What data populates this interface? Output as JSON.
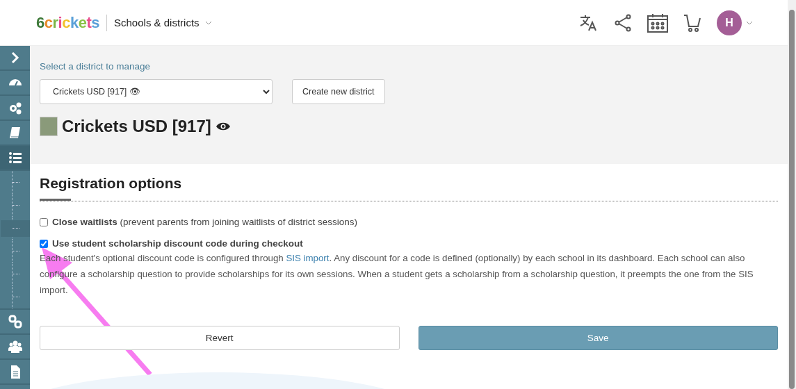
{
  "header": {
    "logo": "6crickets",
    "section": "Schools & districts",
    "avatar": "H"
  },
  "sidebar": {
    "items": [
      {
        "kind": "expand",
        "selected": false
      },
      {
        "kind": "dashboard",
        "selected": false
      },
      {
        "kind": "settings",
        "selected": false
      },
      {
        "kind": "book",
        "selected": false
      },
      {
        "kind": "list",
        "selected": true,
        "children": [
          {
            "selected": false
          },
          {
            "selected": false
          },
          {
            "selected": true
          },
          {
            "selected": false
          },
          {
            "selected": false
          },
          {
            "selected": false
          }
        ]
      },
      {
        "kind": "link",
        "selected": false
      },
      {
        "kind": "users",
        "selected": false
      },
      {
        "kind": "document",
        "selected": false
      }
    ]
  },
  "district": {
    "select_label": "Select a district to manage",
    "selected_district": "Crickets USD [917] 👁",
    "create_button": "Create new district",
    "title": "Crickets USD [917]"
  },
  "registration": {
    "heading": "Registration options",
    "options": [
      {
        "label": "Close waitlists",
        "note": "(prevent parents from joining waitlists of district sessions)",
        "checked": false
      },
      {
        "label": "Use student scholarship discount code during checkout",
        "checked": true,
        "description_before": "Each student's optional discount code is configured through ",
        "link": "SIS import",
        "description_after": ". Any discount for a code is defined (optionally) by each school in its dashboard. Each school can also configure a scholarship question to provide scholarships for its own sessions. When a student gets a scholarship from a scholarship question, it preempts the one from the SIS import."
      }
    ],
    "buttons": [
      {
        "kind": "secondary",
        "label": "Revert"
      },
      {
        "kind": "primary",
        "label": "Save"
      }
    ]
  }
}
